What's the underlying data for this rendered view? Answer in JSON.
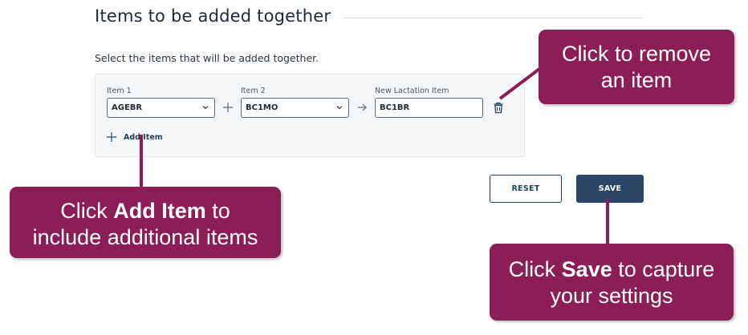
{
  "section": {
    "title": "Items to be added together",
    "instruction": "Select the items that will be added together."
  },
  "items_row": {
    "item1": {
      "label": "Item 1",
      "value": "AGEBR"
    },
    "operator_plus": "plus-icon",
    "item2": {
      "label": "Item 2",
      "value": "BC1MO"
    },
    "operator_arrow": "arrow-right-icon",
    "new_item": {
      "label": "New Lactation Item",
      "value": "BC1BR"
    },
    "remove_icon": "trash-icon"
  },
  "add_item": {
    "label": "Add Item",
    "icon": "plus-icon"
  },
  "buttons": {
    "reset": "RESET",
    "save": "SAVE"
  },
  "callouts": {
    "remove": {
      "line1": "Click to remove",
      "line2": "an item"
    },
    "add": {
      "pre": "Click ",
      "bold": "Add Item",
      "post": " to",
      "line2": "include additional items"
    },
    "save": {
      "pre": "Click ",
      "bold": "Save",
      "post": " to capture",
      "line2": "your settings"
    }
  },
  "colors": {
    "callout": "#8b1f55",
    "primary": "#2a4566",
    "text": "#1e2a36"
  }
}
